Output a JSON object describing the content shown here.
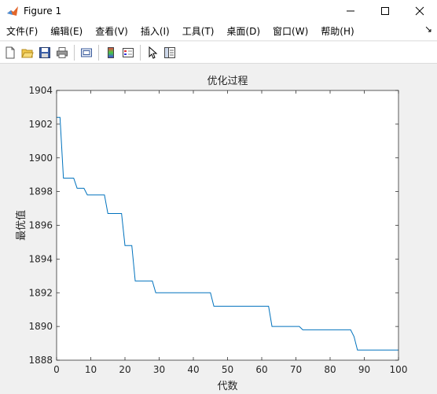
{
  "window": {
    "title": "Figure 1"
  },
  "menu": {
    "items": [
      "文件(F)",
      "编辑(E)",
      "查看(V)",
      "插入(I)",
      "工具(T)",
      "桌面(D)",
      "窗口(W)",
      "帮助(H)"
    ],
    "overflow_glyph": "↘"
  },
  "toolbar": {
    "buttons": [
      "new-figure-icon",
      "open-file-icon",
      "save-icon",
      "print-icon",
      "link-icon",
      "colorbar-icon",
      "legend-icon",
      "pointer-icon",
      "property-editor-icon"
    ]
  },
  "chart_data": {
    "type": "line",
    "title": "优化过程",
    "xlabel": "代数",
    "ylabel": "最优值",
    "xlim": [
      0,
      100
    ],
    "ylim": [
      1888,
      1904
    ],
    "xticks": [
      "0",
      "10",
      "20",
      "30",
      "40",
      "50",
      "60",
      "70",
      "80",
      "90",
      "100"
    ],
    "yticks": [
      "1888",
      "1890",
      "1892",
      "1894",
      "1896",
      "1898",
      "1900",
      "1902",
      "1904"
    ],
    "grid": false,
    "series": [
      {
        "color": "#0072BD",
        "x": [
          0,
          1,
          2,
          3,
          4,
          5,
          6,
          7,
          8,
          9,
          10,
          11,
          12,
          13,
          14,
          15,
          16,
          17,
          18,
          19,
          20,
          21,
          22,
          23,
          24,
          25,
          26,
          27,
          28,
          29,
          30,
          35,
          40,
          45,
          46,
          50,
          55,
          60,
          62,
          63,
          65,
          70,
          71,
          72,
          75,
          80,
          85,
          86,
          87,
          88,
          90,
          95,
          100
        ],
        "y": [
          1902.4,
          1902.4,
          1898.8,
          1898.8,
          1898.8,
          1898.8,
          1898.2,
          1898.2,
          1898.2,
          1897.8,
          1897.8,
          1897.8,
          1897.8,
          1897.8,
          1897.8,
          1896.7,
          1896.7,
          1896.7,
          1896.7,
          1896.7,
          1894.8,
          1894.8,
          1894.8,
          1892.7,
          1892.7,
          1892.7,
          1892.7,
          1892.7,
          1892.7,
          1892.0,
          1892.0,
          1892.0,
          1892.0,
          1892.0,
          1891.2,
          1891.2,
          1891.2,
          1891.2,
          1891.2,
          1890.0,
          1890.0,
          1890.0,
          1890.0,
          1889.8,
          1889.8,
          1889.8,
          1889.8,
          1889.8,
          1889.4,
          1888.6,
          1888.6,
          1888.6,
          1888.6
        ]
      }
    ]
  }
}
